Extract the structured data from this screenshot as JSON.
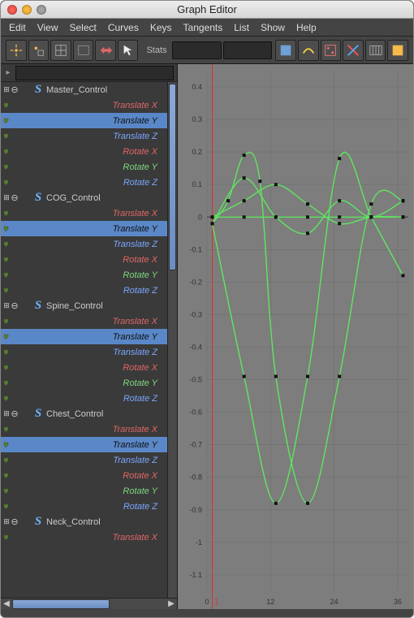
{
  "window": {
    "title": "Graph Editor"
  },
  "menu": [
    "Edit",
    "View",
    "Select",
    "Curves",
    "Keys",
    "Tangents",
    "List",
    "Show",
    "Help"
  ],
  "toolbar": {
    "stats_label": "Stats"
  },
  "outliner": {
    "nodes": [
      {
        "name": "Master_Control",
        "attrs": [
          {
            "label": "Translate X",
            "cls": "tx",
            "sel": false
          },
          {
            "label": "Translate Y",
            "cls": "ty",
            "sel": true
          },
          {
            "label": "Translate Z",
            "cls": "tz",
            "sel": false
          },
          {
            "label": "Rotate X",
            "cls": "rx",
            "sel": false
          },
          {
            "label": "Rotate Y",
            "cls": "ry",
            "sel": false
          },
          {
            "label": "Rotate Z",
            "cls": "rz",
            "sel": false
          }
        ]
      },
      {
        "name": "COG_Control",
        "attrs": [
          {
            "label": "Translate X",
            "cls": "tx",
            "sel": false
          },
          {
            "label": "Translate Y",
            "cls": "ty",
            "sel": true
          },
          {
            "label": "Translate Z",
            "cls": "tz",
            "sel": false
          },
          {
            "label": "Rotate X",
            "cls": "rx",
            "sel": false
          },
          {
            "label": "Rotate Y",
            "cls": "ry",
            "sel": false
          },
          {
            "label": "Rotate Z",
            "cls": "rz",
            "sel": false
          }
        ]
      },
      {
        "name": "Spine_Control",
        "attrs": [
          {
            "label": "Translate X",
            "cls": "tx",
            "sel": false
          },
          {
            "label": "Translate Y",
            "cls": "ty",
            "sel": true
          },
          {
            "label": "Translate Z",
            "cls": "tz",
            "sel": false
          },
          {
            "label": "Rotate X",
            "cls": "rx",
            "sel": false
          },
          {
            "label": "Rotate Y",
            "cls": "ry",
            "sel": false
          },
          {
            "label": "Rotate Z",
            "cls": "rz",
            "sel": false
          }
        ]
      },
      {
        "name": "Chest_Control",
        "attrs": [
          {
            "label": "Translate X",
            "cls": "tx",
            "sel": false
          },
          {
            "label": "Translate Y",
            "cls": "ty",
            "sel": true
          },
          {
            "label": "Translate Z",
            "cls": "tz",
            "sel": false
          },
          {
            "label": "Rotate X",
            "cls": "rx",
            "sel": false
          },
          {
            "label": "Rotate Y",
            "cls": "ry",
            "sel": false
          },
          {
            "label": "Rotate Z",
            "cls": "rz",
            "sel": false
          }
        ]
      },
      {
        "name": "Neck_Control",
        "attrs": [
          {
            "label": "Translate X",
            "cls": "tx",
            "sel": false
          }
        ]
      }
    ]
  },
  "chart_data": {
    "type": "line",
    "xlabel": "",
    "ylabel": "",
    "xlim": [
      0,
      38
    ],
    "ylim": [
      -1.15,
      0.45
    ],
    "xticks": [
      0,
      12,
      24,
      36
    ],
    "yticks": [
      -1.1,
      -1.0,
      -0.9,
      -0.8,
      -0.7,
      -0.6,
      -0.5,
      -0.4,
      -0.3,
      -0.2,
      -0.1,
      0,
      0.1,
      0.2,
      0.3,
      0.4
    ],
    "playhead_x": 1,
    "series": [
      {
        "name": "Master_Control.ty",
        "color": "#5fe65f",
        "x": [
          1,
          7,
          13,
          19,
          25,
          31,
          37
        ],
        "y": [
          0.0,
          0.0,
          0.0,
          0.0,
          0.0,
          0.0,
          0.0
        ]
      },
      {
        "name": "COG_Control.ty",
        "color": "#5fe65f",
        "x": [
          1,
          4,
          7,
          10,
          13,
          19,
          25,
          31,
          37
        ],
        "y": [
          -0.02,
          0.05,
          0.19,
          0.11,
          -0.49,
          -0.88,
          -0.49,
          0.04,
          0.05
        ]
      },
      {
        "name": "Spine_Control.ty",
        "color": "#5fe65f",
        "x": [
          1,
          7,
          13,
          19,
          25,
          31,
          37
        ],
        "y": [
          -0.02,
          -0.49,
          -0.88,
          -0.49,
          0.18,
          0.0,
          -0.18
        ]
      },
      {
        "name": "Chest_Control.ty",
        "color": "#5fe65f",
        "x": [
          1,
          7,
          13,
          19,
          25,
          31,
          37
        ],
        "y": [
          -0.02,
          0.12,
          0.0,
          -0.05,
          0.05,
          0.0,
          0.05
        ]
      },
      {
        "name": "Neck_Control.ty",
        "color": "#5fe65f",
        "x": [
          1,
          7,
          13,
          19,
          25,
          31,
          37
        ],
        "y": [
          0.0,
          0.05,
          0.1,
          0.04,
          -0.02,
          0.0,
          0.0
        ]
      }
    ]
  }
}
